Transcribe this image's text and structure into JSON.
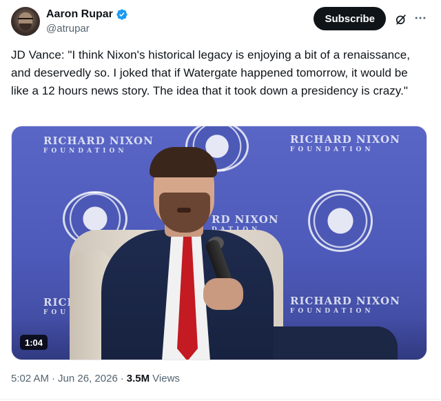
{
  "author": {
    "display_name": "Aaron Rupar",
    "handle": "@atrupar",
    "verified_icon": "verified-badge-icon",
    "verified_color": "#1d9bf0"
  },
  "actions": {
    "subscribe_label": "Subscribe",
    "grok_icon": "grok-icon",
    "more_icon": "more-options-icon"
  },
  "tweet": {
    "text": "JD Vance: \"I think Nixon's historical legacy is enjoying a bit of a renaissance, and deservedly so. I joked that if Watergate happened tomorrow, it would be like a 12 hours news story. The idea that it took down a presidency is crazy.\""
  },
  "media": {
    "duration": "1:04",
    "backdrop_text": [
      {
        "line1": "RICHARD NIXON",
        "line2": "FOUNDATION"
      },
      {
        "line1": "RICHARD NIXON",
        "line2": "FOUNDATION"
      },
      {
        "line1": "RD NIXON",
        "line2": "DATION"
      },
      {
        "line1": "RICHARD NIXON",
        "line2": "FOUNDATION"
      },
      {
        "line1": "RICH",
        "line2": "FOU"
      }
    ]
  },
  "meta": {
    "time": "5:02 AM",
    "separator": "·",
    "date": "Jun 26, 2026",
    "separator2": "·",
    "views_count": "3.5M",
    "views_label": "Views"
  }
}
